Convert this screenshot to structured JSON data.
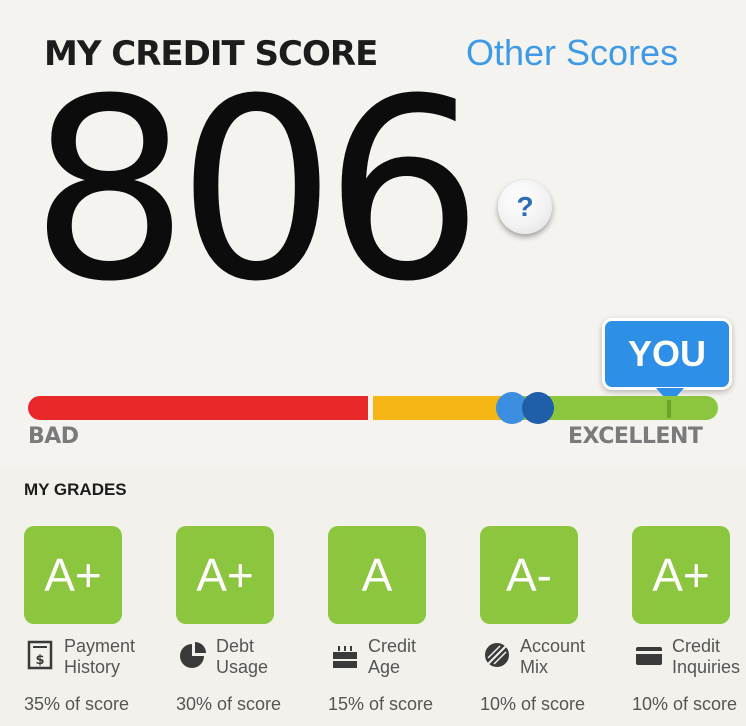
{
  "header": {
    "title": "MY CREDIT SCORE",
    "other_scores_link": "Other Scores"
  },
  "score": {
    "value": "806",
    "help_label": "?"
  },
  "range": {
    "low_label": "BAD",
    "high_label": "EXCELLENT",
    "marker_label": "YOU",
    "colors": {
      "bad": "#e8282a",
      "fair": "#f5b616",
      "good": "#8cc63f"
    }
  },
  "grades": {
    "heading": "MY GRADES",
    "items": [
      {
        "grade": "A+",
        "line1": "Payment",
        "line2": "History",
        "percent": "35% of score",
        "icon": "payment-history-icon"
      },
      {
        "grade": "A+",
        "line1": "Debt",
        "line2": "Usage",
        "percent": "30% of score",
        "icon": "pie-chart-icon"
      },
      {
        "grade": "A",
        "line1": "Credit",
        "line2": "Age",
        "percent": "15% of score",
        "icon": "birthday-cake-icon"
      },
      {
        "grade": "A-",
        "line1": "Account",
        "line2": "Mix",
        "percent": "10% of score",
        "icon": "striped-pie-icon"
      },
      {
        "grade": "A+",
        "line1": "Credit",
        "line2": "Inquiries",
        "percent": "10% of score",
        "icon": "credit-card-icon"
      }
    ]
  }
}
